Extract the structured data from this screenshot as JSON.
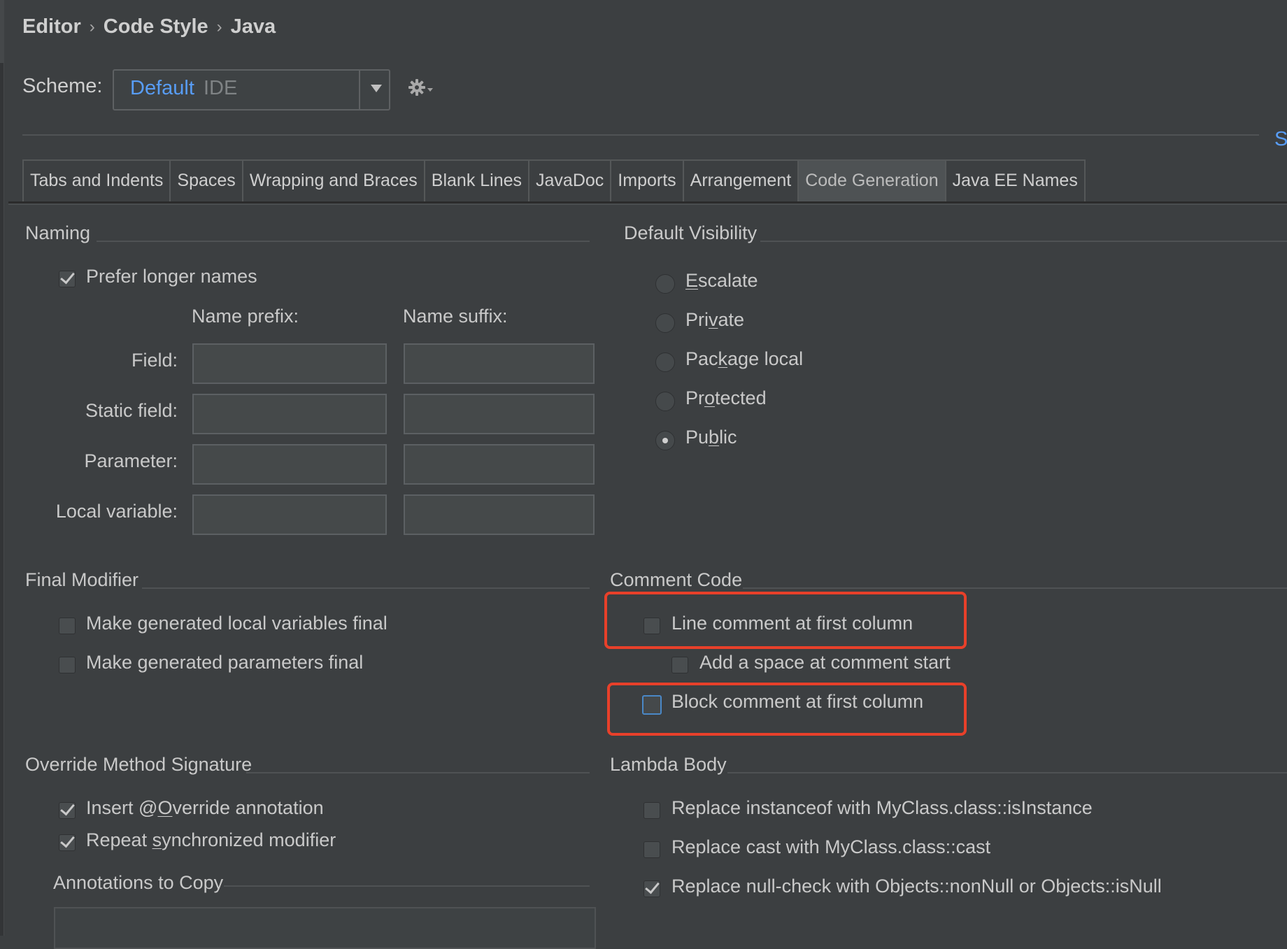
{
  "breadcrumb": [
    "Editor",
    "Code Style",
    "Java"
  ],
  "scheme": {
    "label": "Scheme:",
    "name": "Default",
    "type": "IDE"
  },
  "edge_link": "S",
  "tabs": [
    {
      "label": "Tabs and Indents",
      "active": false
    },
    {
      "label": "Spaces",
      "active": false
    },
    {
      "label": "Wrapping and Braces",
      "active": false
    },
    {
      "label": "Blank Lines",
      "active": false
    },
    {
      "label": "JavaDoc",
      "active": false
    },
    {
      "label": "Imports",
      "active": false
    },
    {
      "label": "Arrangement",
      "active": false
    },
    {
      "label": "Code Generation",
      "active": true
    },
    {
      "label": "Java EE Names",
      "active": false
    }
  ],
  "naming": {
    "title": "Naming",
    "prefer_longer": {
      "label": "Prefer longer names",
      "checked": true
    },
    "prefix_header": "Name prefix:",
    "suffix_header": "Name suffix:",
    "rows": [
      {
        "label": "Field:",
        "prefix": "",
        "suffix": ""
      },
      {
        "label": "Static field:",
        "prefix": "",
        "suffix": ""
      },
      {
        "label": "Parameter:",
        "prefix": "",
        "suffix": ""
      },
      {
        "label": "Local variable:",
        "prefix": "",
        "suffix": ""
      }
    ]
  },
  "visibility": {
    "title": "Default Visibility",
    "options": [
      {
        "pre": "",
        "u": "E",
        "post": "scalate",
        "selected": false
      },
      {
        "pre": "Pri",
        "u": "v",
        "post": "ate",
        "selected": false
      },
      {
        "pre": "Pac",
        "u": "k",
        "post": "age local",
        "selected": false
      },
      {
        "pre": "Pr",
        "u": "o",
        "post": "tected",
        "selected": false
      },
      {
        "pre": "Pu",
        "u": "b",
        "post": "lic",
        "selected": true
      }
    ]
  },
  "final_modifier": {
    "title": "Final Modifier",
    "items": [
      {
        "label": "Make generated local variables final",
        "checked": false
      },
      {
        "label": "Make generated parameters final",
        "checked": false
      }
    ]
  },
  "comment_code": {
    "title": "Comment Code",
    "line_comment": {
      "label": "Line comment at first column",
      "checked": false
    },
    "add_space": {
      "label": "Add a space at comment start",
      "checked": false
    },
    "block_comment": {
      "label": "Block comment at first column",
      "checked": false
    }
  },
  "override": {
    "title": "Override Method Signature",
    "insert": {
      "pre": "Insert @",
      "u": "O",
      "post": "verride annotation",
      "checked": true
    },
    "repeat": {
      "pre": "Repeat ",
      "u": "s",
      "post": "ynchronized modifier",
      "checked": true
    },
    "annotations_title": "Annotations to Copy"
  },
  "lambda": {
    "title": "Lambda Body",
    "items": [
      {
        "label": "Replace instanceof with MyClass.class::isInstance",
        "checked": false
      },
      {
        "label": "Replace cast with MyClass.class::cast",
        "checked": false
      },
      {
        "label": "Replace null-check with Objects::nonNull or Objects::isNull",
        "checked": true
      }
    ]
  },
  "colors": {
    "background": "#3c3f41",
    "accent": "#589df6",
    "highlight": "#e8402a"
  },
  "icons": [
    "gear-icon",
    "chevron-down-icon",
    "breadcrumb-separator-icon"
  ]
}
